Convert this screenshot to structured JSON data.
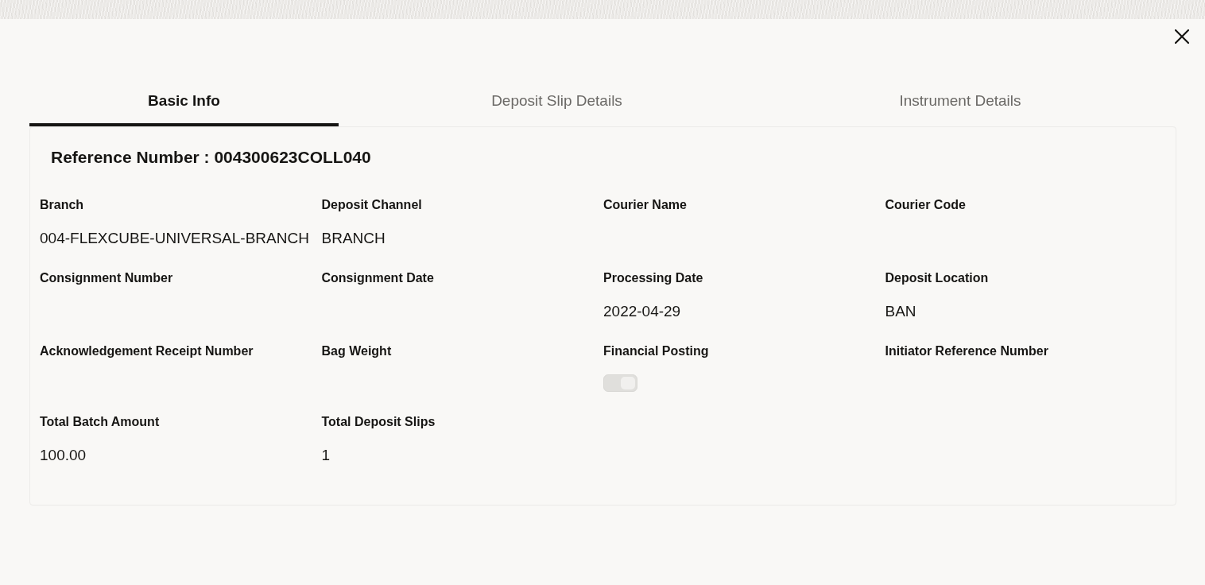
{
  "tabs": [
    {
      "label": "Basic Info",
      "selected": true
    },
    {
      "label": "Deposit Slip Details",
      "selected": false
    },
    {
      "label": "Instrument Details",
      "selected": false
    }
  ],
  "heading": "Reference Number : 004300623COLL040",
  "fields": [
    {
      "kind": "text",
      "label": "Branch",
      "value": "004-FLEXCUBE-UNIVERSAL-BRANCH"
    },
    {
      "kind": "text",
      "label": "Deposit Channel",
      "value": "BRANCH"
    },
    {
      "kind": "text",
      "label": "Courier Name"
    },
    {
      "kind": "text",
      "label": "Courier Code"
    },
    {
      "kind": "text",
      "label": "Consignment Number"
    },
    {
      "kind": "text",
      "label": "Consignment Date"
    },
    {
      "kind": "text",
      "label": "Processing Date",
      "value": "2022-04-29"
    },
    {
      "kind": "text",
      "label": "Deposit Location",
      "value": "BAN"
    },
    {
      "kind": "text",
      "label": "Acknowledgement Receipt Number"
    },
    {
      "kind": "text",
      "label": "Bag Weight"
    },
    {
      "kind": "toggle",
      "label": "Financial Posting",
      "on": true,
      "disabled": true
    },
    {
      "kind": "text",
      "label": "Initiator Reference Number"
    },
    {
      "kind": "text",
      "label": "Total Batch Amount",
      "value": "100.00"
    },
    {
      "kind": "text",
      "label": "Total Deposit Slips",
      "value": "1"
    }
  ]
}
